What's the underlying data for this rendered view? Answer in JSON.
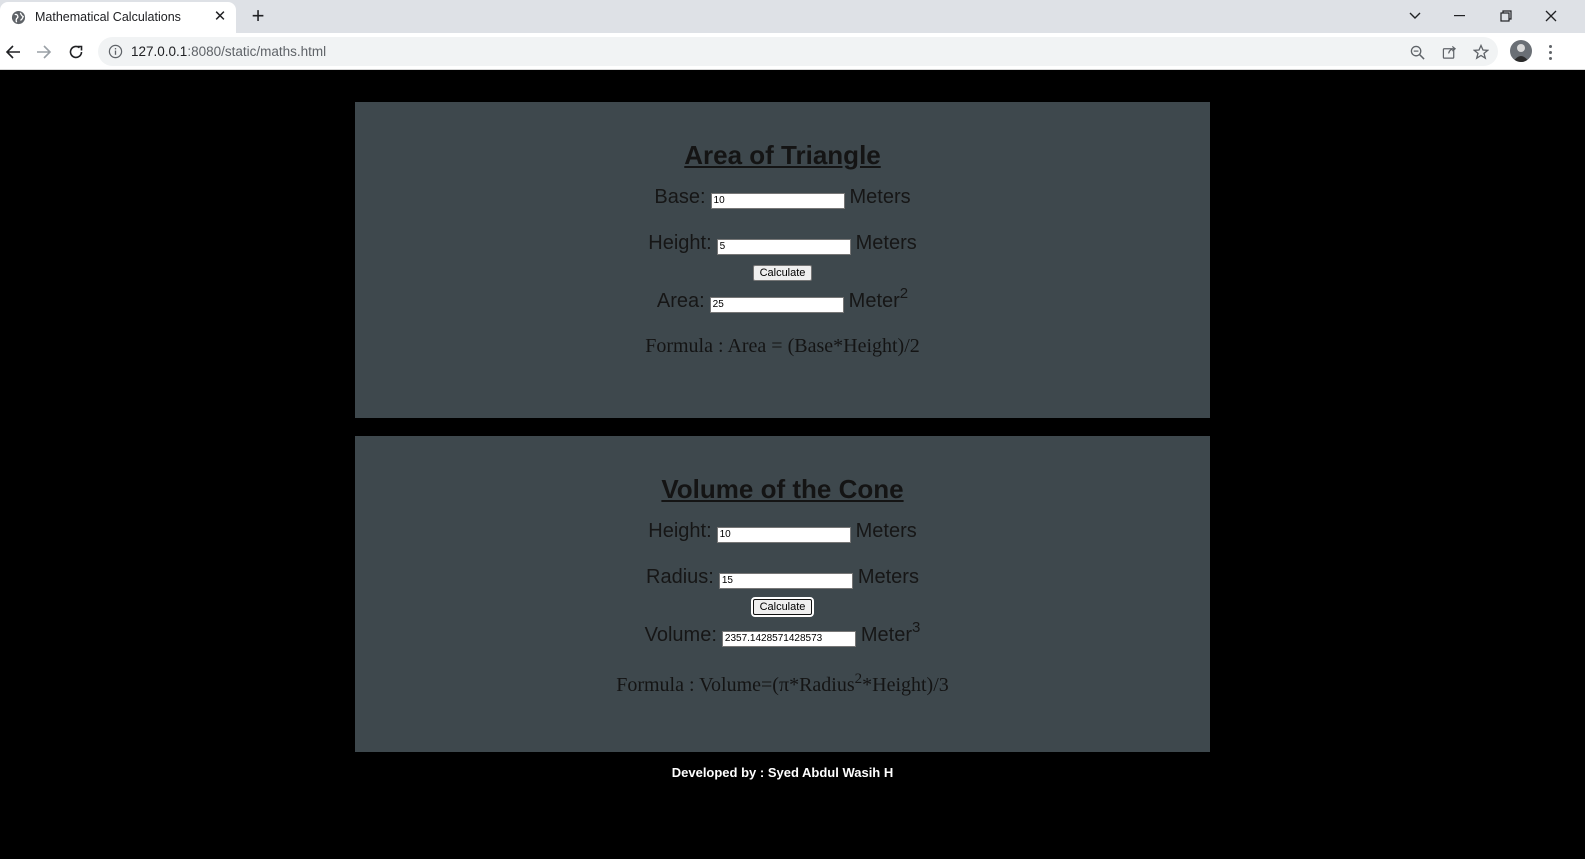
{
  "browser": {
    "tab_title": "Mathematical Calculations",
    "new_tab_label": "+",
    "url_host": "127.0.0.1",
    "url_rest": ":8080/static/maths.html"
  },
  "triangle": {
    "title": "Area of Triangle",
    "base_label": "Base:",
    "base_value": "10",
    "base_unit": "Meters",
    "height_label": "Height:",
    "height_value": "5",
    "height_unit": "Meters",
    "button_label": "Calculate",
    "area_label": "Area:",
    "area_value": "25",
    "area_unit": "Meter",
    "area_unit_exp": "2",
    "formula": "Formula : Area = (Base*Height)/2"
  },
  "cone": {
    "title": "Volume of the Cone",
    "height_label": "Height:",
    "height_value": "10",
    "height_unit": "Meters",
    "radius_label": "Radius:",
    "radius_value": "15",
    "radius_unit": "Meters",
    "button_label": "Calculate",
    "volume_label": "Volume:",
    "volume_value": "2357.1428571428573",
    "volume_unit": "Meter",
    "volume_unit_exp": "3",
    "formula_pre": "Formula : Volume=(π*Radius",
    "formula_exp": "2",
    "formula_post": "*Height)/3"
  },
  "footer": {
    "text": "Developed by : Syed Abdul Wasih H"
  }
}
